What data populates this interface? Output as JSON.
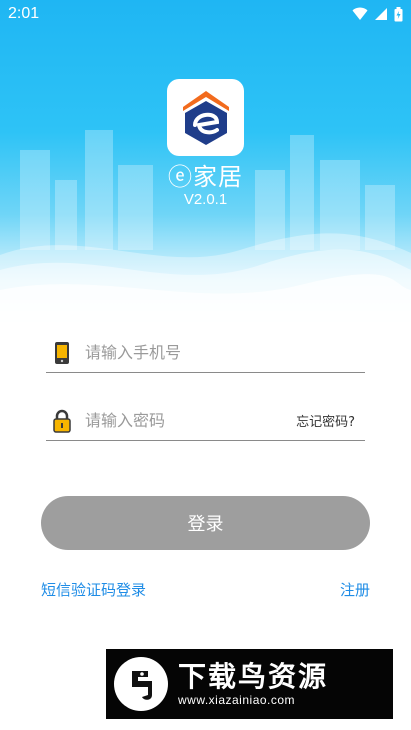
{
  "status_bar": {
    "time": "2:01",
    "icons": [
      "wifi-icon",
      "signal-icon",
      "battery-icon"
    ]
  },
  "header": {
    "app_name": "ⓔ家居",
    "version": "V2.0.1",
    "logo_icon": "house-e-logo-icon",
    "colors": {
      "background_top": "#1fb6f3",
      "logo_navy": "#1f3d8a",
      "logo_orange": "#f26b1d"
    }
  },
  "form": {
    "phone": {
      "placeholder": "请输入手机号",
      "value": "",
      "icon": "phone-icon"
    },
    "password": {
      "placeholder": "请输入密码",
      "value": "",
      "icon": "lock-icon",
      "forgot_label": "忘记密码?"
    }
  },
  "actions": {
    "login_label": "登录",
    "sms_login_label": "短信验证码登录",
    "register_label": "注册",
    "colors": {
      "button_disabled": "#9e9e9e",
      "link": "#1e8ce6"
    }
  },
  "watermark": {
    "title": "下载鸟资源",
    "url": "www.xiazainiao.com"
  }
}
